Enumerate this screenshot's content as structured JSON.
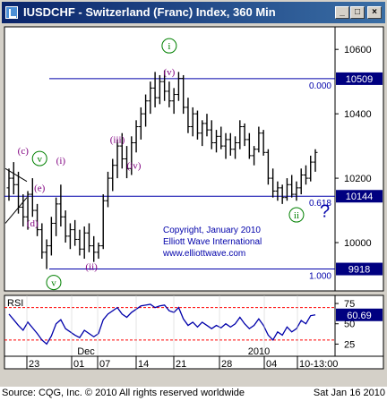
{
  "window": {
    "title": "IUSDCHF - Switzerland (Franc) Index, 360 Min",
    "buttons": {
      "minimize": "_",
      "maximize": "□",
      "close": "×"
    }
  },
  "footer": {
    "source": "Source: CQG, Inc. © 2010 All rights reserved worldwide",
    "date": "Sat Jan 16 2010"
  },
  "colors": {
    "background": "#ffffff",
    "bars": "#000000",
    "lines": "#0000aa",
    "wave_labels": "#800080",
    "circle_labels": "#008000",
    "rsi_dashed": "#ff0000",
    "axis_highlight": "#000080"
  },
  "chart_data": [
    {
      "type": "ohlc",
      "symbol": "IUSDCHF",
      "ylim": [
        9850,
        10670
      ],
      "y_ticks": [
        10600,
        10400,
        10200,
        10000,
        9800
      ],
      "x_ticks": [
        "23",
        "01",
        "07",
        "14",
        "21",
        "28",
        "04",
        "10-13:00"
      ],
      "month_labels": [
        "Dec",
        "2010"
      ],
      "price_tags": [
        {
          "value": "10509",
          "level": 10509
        },
        {
          "value": "10144",
          "level": 10144
        },
        {
          "value": "9918",
          "level": 9918
        }
      ],
      "fib_levels": [
        {
          "label": "0.000",
          "value": 10509
        },
        {
          "label": "0.618",
          "value": 10144
        },
        {
          "label": "1.000",
          "value": 9918
        }
      ],
      "wave_labels": [
        {
          "text": "i",
          "style": "circled",
          "x": 34,
          "y": 10600
        },
        {
          "text": "(v)",
          "style": "plain",
          "x": 34,
          "y": 10520
        },
        {
          "text": "(iii)",
          "style": "plain",
          "x": 23,
          "y": 10310
        },
        {
          "text": "(iv)",
          "style": "plain",
          "x": 26.5,
          "y": 10230
        },
        {
          "text": "(i)",
          "style": "plain",
          "x": 11,
          "y": 10245
        },
        {
          "text": "(c)",
          "style": "plain",
          "x": 3,
          "y": 10275
        },
        {
          "text": "v",
          "style": "circled",
          "x": 6.5,
          "y": 10250
        },
        {
          "text": "(e)",
          "style": "plain",
          "x": 6.5,
          "y": 10160
        },
        {
          "text": "(d)",
          "style": "plain",
          "x": 5,
          "y": 10050
        },
        {
          "text": "v",
          "style": "circled",
          "x": 9.5,
          "y": 9865
        },
        {
          "text": "(ii)",
          "style": "plain",
          "x": 17.5,
          "y": 9915
        },
        {
          "text": "ii",
          "style": "circled",
          "x": 61,
          "y": 10075
        },
        {
          "text": "?",
          "style": "plain",
          "x": 67,
          "y": 10080
        }
      ],
      "annotation": [
        "Copyright, January 2010",
        "Elliott Wave International",
        "www.elliottwave.com"
      ],
      "bars": [
        [
          10170,
          10230,
          10130,
          10200
        ],
        [
          10200,
          10250,
          10150,
          10180
        ],
        [
          10180,
          10220,
          10090,
          10110
        ],
        [
          10110,
          10150,
          10050,
          10080
        ],
        [
          10080,
          10160,
          10040,
          10150
        ],
        [
          10150,
          10200,
          10080,
          10100
        ],
        [
          10100,
          10120,
          10020,
          10040
        ],
        [
          10040,
          10060,
          9950,
          9970
        ],
        [
          9970,
          10010,
          9918,
          9990
        ],
        [
          9990,
          10080,
          9960,
          10060
        ],
        [
          10060,
          10140,
          10020,
          10120
        ],
        [
          10120,
          10180,
          10050,
          10080
        ],
        [
          10080,
          10100,
          10000,
          10020
        ],
        [
          10020,
          10060,
          9980,
          10040
        ],
        [
          10040,
          10070,
          9990,
          10010
        ],
        [
          10010,
          10040,
          9960,
          9980
        ],
        [
          9980,
          10050,
          9950,
          10030
        ],
        [
          10030,
          10060,
          9970,
          9990
        ],
        [
          9990,
          10020,
          9940,
          9970
        ],
        [
          9970,
          10000,
          9950,
          9990
        ],
        [
          9990,
          10150,
          9980,
          10130
        ],
        [
          10130,
          10220,
          10110,
          10200
        ],
        [
          10200,
          10260,
          10160,
          10240
        ],
        [
          10240,
          10320,
          10200,
          10300
        ],
        [
          10300,
          10340,
          10230,
          10260
        ],
        [
          10260,
          10300,
          10200,
          10230
        ],
        [
          10230,
          10330,
          10210,
          10310
        ],
        [
          10310,
          10380,
          10280,
          10360
        ],
        [
          10360,
          10420,
          10320,
          10400
        ],
        [
          10400,
          10460,
          10360,
          10440
        ],
        [
          10440,
          10500,
          10400,
          10480
        ],
        [
          10480,
          10530,
          10420,
          10450
        ],
        [
          10450,
          10520,
          10430,
          10500
        ],
        [
          10500,
          10535,
          10440,
          10470
        ],
        [
          10470,
          10500,
          10420,
          10440
        ],
        [
          10440,
          10480,
          10400,
          10460
        ],
        [
          10460,
          10530,
          10440,
          10510
        ],
        [
          10510,
          10520,
          10400,
          10420
        ],
        [
          10420,
          10450,
          10340,
          10360
        ],
        [
          10360,
          10420,
          10330,
          10400
        ],
        [
          10400,
          10410,
          10320,
          10340
        ],
        [
          10340,
          10380,
          10300,
          10370
        ],
        [
          10370,
          10400,
          10330,
          10350
        ],
        [
          10350,
          10380,
          10290,
          10310
        ],
        [
          10310,
          10350,
          10280,
          10330
        ],
        [
          10330,
          10360,
          10290,
          10300
        ],
        [
          10300,
          10340,
          10260,
          10320
        ],
        [
          10320,
          10340,
          10270,
          10290
        ],
        [
          10290,
          10330,
          10260,
          10310
        ],
        [
          10310,
          10380,
          10290,
          10360
        ],
        [
          10360,
          10370,
          10300,
          10320
        ],
        [
          10320,
          10340,
          10260,
          10270
        ],
        [
          10270,
          10300,
          10240,
          10290
        ],
        [
          10290,
          10360,
          10280,
          10340
        ],
        [
          10340,
          10350,
          10270,
          10280
        ],
        [
          10280,
          10290,
          10180,
          10200
        ],
        [
          10200,
          10230,
          10140,
          10160
        ],
        [
          10160,
          10190,
          10130,
          10170
        ],
        [
          10170,
          10180,
          10120,
          10140
        ],
        [
          10140,
          10200,
          10130,
          10180
        ],
        [
          10180,
          10210,
          10140,
          10150
        ],
        [
          10150,
          10190,
          10130,
          10170
        ],
        [
          10170,
          10230,
          10150,
          10210
        ],
        [
          10210,
          10240,
          10180,
          10200
        ],
        [
          10200,
          10270,
          10190,
          10250
        ],
        [
          10250,
          10290,
          10220,
          10280
        ]
      ]
    },
    {
      "type": "line",
      "name": "RSI",
      "ylim": [
        10,
        85
      ],
      "y_ticks": [
        75,
        50,
        25
      ],
      "current_value": "60.69",
      "dashed_levels": [
        70,
        30
      ],
      "values": [
        62,
        55,
        48,
        42,
        52,
        45,
        38,
        30,
        25,
        35,
        50,
        55,
        44,
        40,
        36,
        33,
        42,
        38,
        34,
        38,
        55,
        62,
        66,
        70,
        62,
        58,
        64,
        68,
        72,
        73,
        74,
        70,
        72,
        73,
        66,
        64,
        70,
        56,
        48,
        52,
        46,
        52,
        48,
        44,
        48,
        45,
        50,
        46,
        50,
        58,
        50,
        44,
        48,
        56,
        48,
        36,
        30,
        40,
        36,
        46,
        40,
        44,
        54,
        50,
        60,
        61
      ]
    }
  ]
}
